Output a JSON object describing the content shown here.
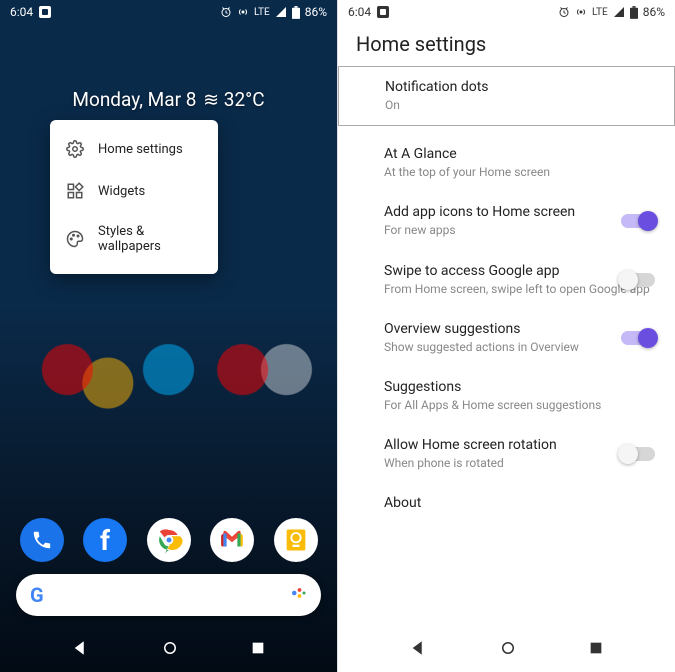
{
  "statusbar": {
    "time": "6:04",
    "lte": "LTE",
    "battery": "86%"
  },
  "home": {
    "date": "Monday, Mar 8",
    "temp": "32°C",
    "popup": {
      "home_settings": "Home settings",
      "widgets": "Widgets",
      "styles": "Styles & wallpapers"
    }
  },
  "settings": {
    "title": "Home settings",
    "items": [
      {
        "title": "Notification dots",
        "sub": "On",
        "toggle": null,
        "boxed": true
      },
      {
        "title": "At A Glance",
        "sub": "At the top of your Home screen",
        "toggle": null
      },
      {
        "title": "Add app icons to Home screen",
        "sub": "For new apps",
        "toggle": "on"
      },
      {
        "title": "Swipe to access Google app",
        "sub": "From Home screen, swipe left to open Google app",
        "toggle": "off"
      },
      {
        "title": "Overview suggestions",
        "sub": "Show suggested actions in Overview",
        "toggle": "on"
      },
      {
        "title": "Suggestions",
        "sub": "For All Apps & Home screen suggestions",
        "toggle": null
      },
      {
        "title": "Allow Home screen rotation",
        "sub": "When phone is rotated",
        "toggle": "off"
      },
      {
        "title": "About",
        "sub": "",
        "toggle": null
      }
    ]
  }
}
